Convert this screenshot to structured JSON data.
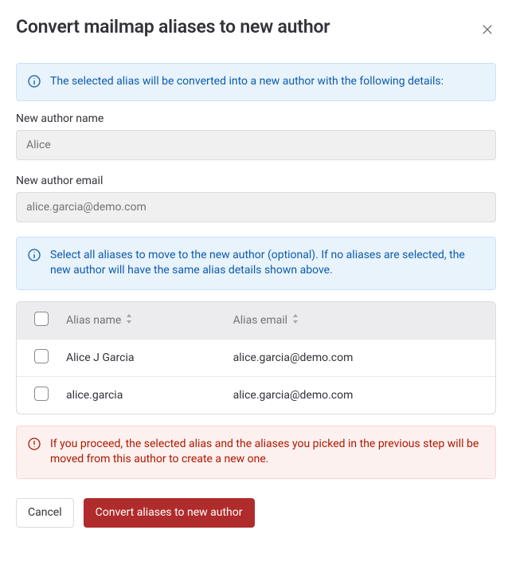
{
  "header": {
    "title": "Convert mailmap aliases to new author"
  },
  "alerts": {
    "info1": "The selected alias will be converted into a new author with the following details:",
    "info2": "Select all aliases to move to the new author (optional). If no aliases are selected, the new author will have the same alias details shown above.",
    "warning": "If you proceed, the selected alias and the aliases you picked in the previous step will be moved from this author to create a new one."
  },
  "form": {
    "name_label": "New author name",
    "name_value": "Alice",
    "email_label": "New author email",
    "email_value": "alice.garcia@demo.com"
  },
  "table": {
    "headers": {
      "name": "Alias name",
      "email": "Alias email"
    },
    "rows": [
      {
        "name": "Alice J  Garcia",
        "email": "alice.garcia@demo.com"
      },
      {
        "name": "alice.garcia",
        "email": "alice.garcia@demo.com"
      }
    ]
  },
  "buttons": {
    "cancel": "Cancel",
    "confirm": "Convert aliases to new author"
  }
}
